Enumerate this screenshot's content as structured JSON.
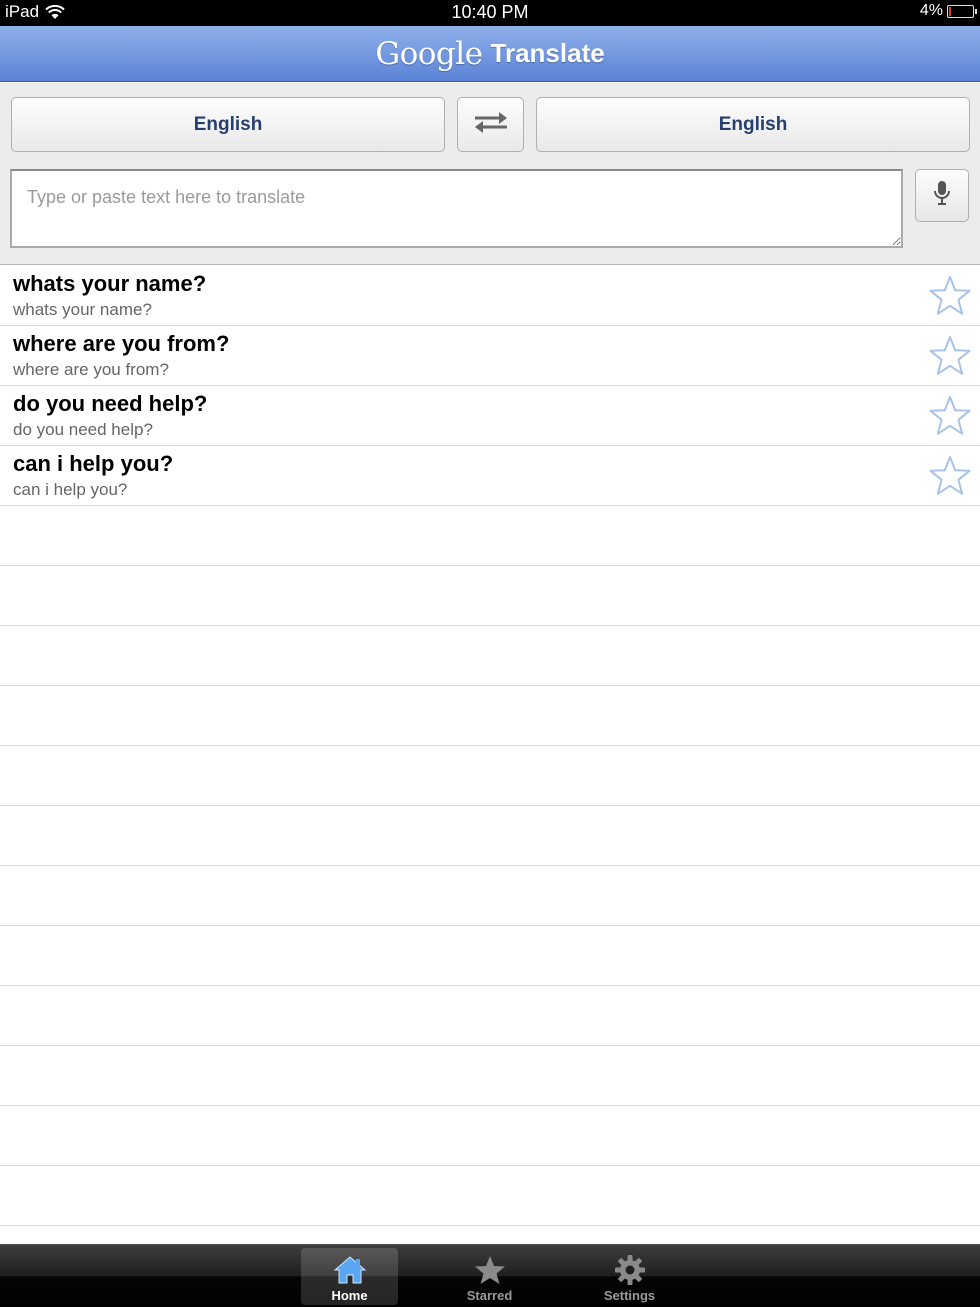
{
  "status_bar": {
    "device": "iPad",
    "time": "10:40 PM",
    "battery": "4%",
    "battery_level": 0.04
  },
  "header": {
    "brand": "Google",
    "title": "Translate"
  },
  "languages": {
    "source": "English",
    "target": "English"
  },
  "input": {
    "placeholder": "Type or paste text here to translate",
    "value": ""
  },
  "history": [
    {
      "source": "whats your name?",
      "translation": "whats your name?"
    },
    {
      "source": "where are you from?",
      "translation": "where are you from?"
    },
    {
      "source": "do you need help?",
      "translation": "do you need help?"
    },
    {
      "source": "can i help you?",
      "translation": "can i help you?"
    }
  ],
  "tabs": [
    {
      "label": "Home",
      "icon": "home-icon",
      "active": true
    },
    {
      "label": "Starred",
      "icon": "star-icon",
      "active": false
    },
    {
      "label": "Settings",
      "icon": "gear-icon",
      "active": false
    }
  ],
  "colors": {
    "header": "#6f93df",
    "star": "#a7c3e8",
    "home_icon": "#5aa6f2"
  }
}
